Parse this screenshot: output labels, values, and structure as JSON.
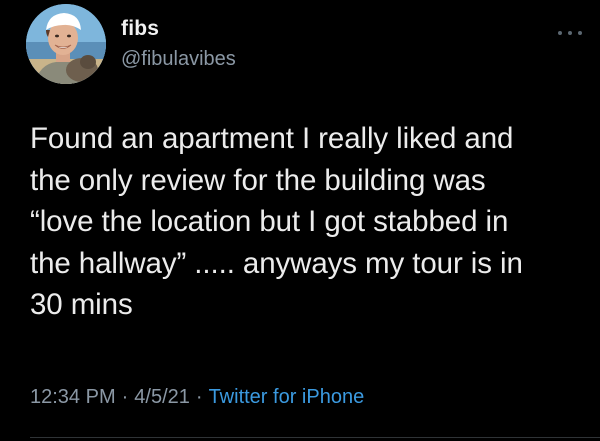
{
  "tweet": {
    "author": {
      "display_name": "fibs",
      "handle": "@fibulavibes"
    },
    "text_lines": [
      "Found an apartment I really liked and",
      "the only review for the building was",
      "“love the location but I got stabbed in",
      "the hallway” ..... anyways my tour is in",
      "30 mins"
    ],
    "meta": {
      "time": "12:34 PM",
      "separator": "·",
      "date": "4/5/21",
      "source": "Twitter for iPhone"
    }
  },
  "colors": {
    "background": "#000000",
    "text": "#ececec",
    "secondary": "#8b98a5",
    "link": "#3b9ae0"
  },
  "icons": {
    "more": "more-horizontal-icon"
  }
}
